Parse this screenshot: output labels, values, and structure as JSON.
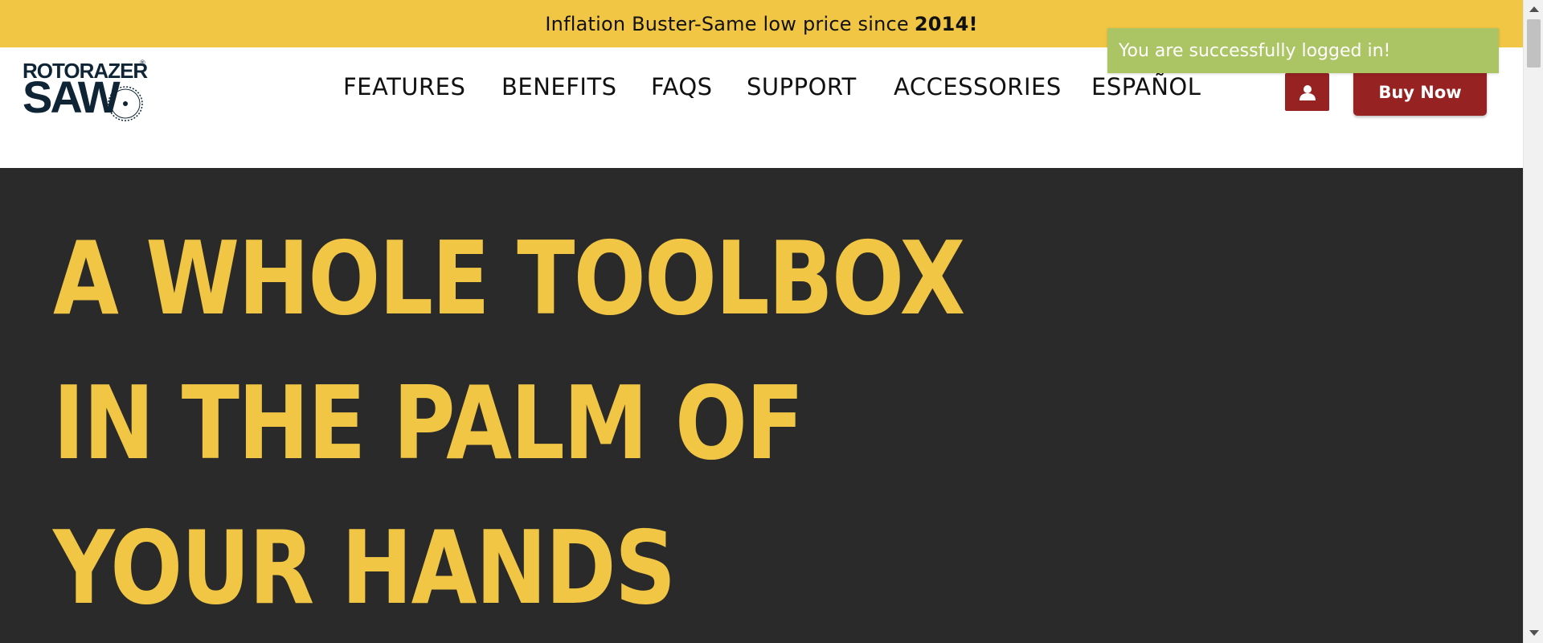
{
  "promo": {
    "text": "Inflation Buster-Same low price since",
    "year": "2014!"
  },
  "logo": {
    "line1": "ROTORAZER",
    "registered": "®",
    "line2": "SAW"
  },
  "nav": {
    "items": [
      {
        "label": "FEATURES"
      },
      {
        "label": "BENEFITS"
      },
      {
        "label": "FAQS"
      },
      {
        "label": "SUPPORT"
      },
      {
        "label": "ACCESSORIES"
      },
      {
        "label": "ESPAÑOL"
      }
    ]
  },
  "header": {
    "account_icon": "user-icon",
    "buy_label": "Buy Now"
  },
  "toast": {
    "message": "You are successfully logged in!"
  },
  "hero": {
    "lines": [
      "A WHOLE TOOLBOX",
      "IN THE PALM OF",
      "YOUR HANDS"
    ]
  },
  "colors": {
    "brand_yellow": "#f1c644",
    "brand_red": "#962222",
    "hero_bg": "#2a2a2a",
    "toast_green": "#acc564",
    "logo_navy": "#0f2536"
  }
}
